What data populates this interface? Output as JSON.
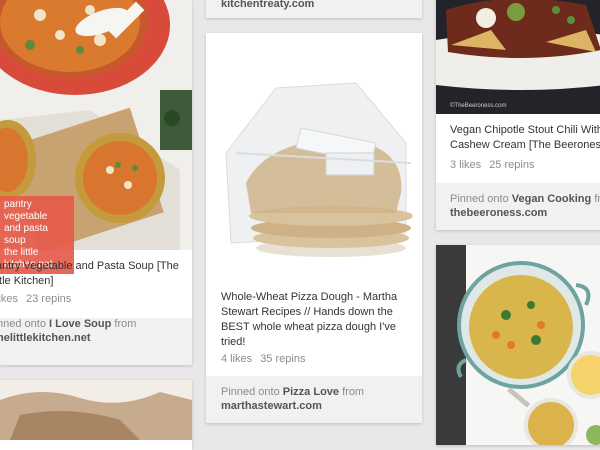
{
  "pins": {
    "soup": {
      "overlay_lines": [
        "pantry vegetable",
        "and pasta soup",
        "the little kitchen.net"
      ],
      "description": "antry Vegetable and Pasta Soup [The ttle Kitchen]",
      "likes": "likes",
      "repins": "23 repins",
      "pinned_prefix": "nned onto",
      "board": "I Love Soup",
      "from": "from",
      "source": "helittlekitchen.net"
    },
    "top_middle": {
      "source": "kitchentreaty.com"
    },
    "pizza": {
      "description": "Whole-Wheat Pizza Dough - Martha Stewart Recipes // Hands down the BEST whole wheat pizza dough I've tried!",
      "likes": "4 likes",
      "repins": "35 repins",
      "pinned_prefix": "Pinned onto",
      "board": "Pizza Love",
      "from": "from",
      "source": "marthastewart.com"
    },
    "chili": {
      "watermark": "©TheBeeroness.com",
      "description": "Vegan Chipotle Stout Chili With Cashew Cream [The Beeroness",
      "likes": "3 likes",
      "repins": "25 repins",
      "pinned_prefix": "Pinned onto",
      "board": "Vegan Cooking",
      "from": "from",
      "source": "thebeeroness.com"
    }
  },
  "colors": {
    "page_bg": "#e9e7e7",
    "footer_bg": "#f2f0f0",
    "overlay": "#e55a4a"
  }
}
